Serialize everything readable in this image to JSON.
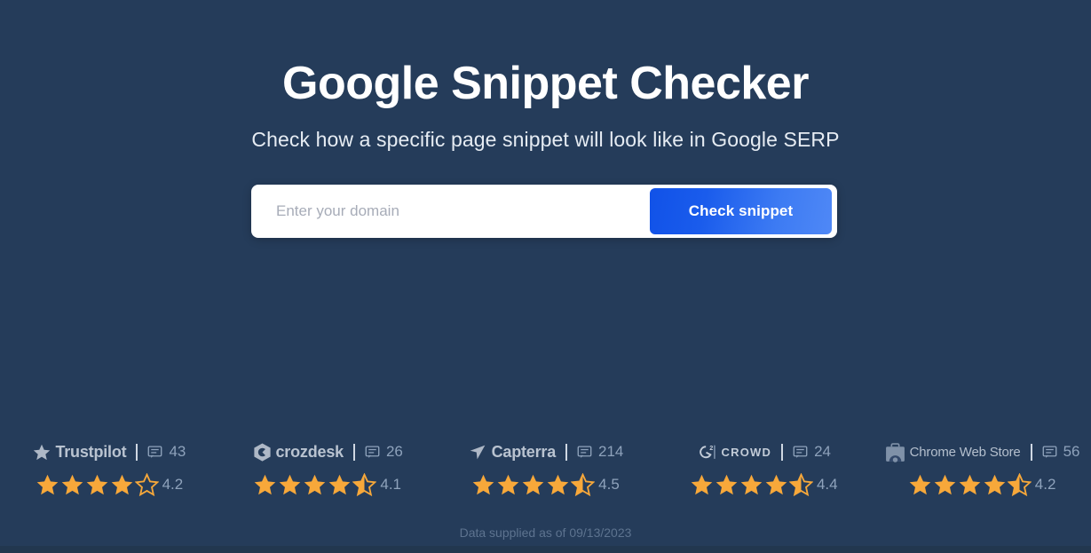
{
  "hero": {
    "title": "Google Snippet Checker",
    "subtitle": "Check how a specific page snippet will look like in Google SERP"
  },
  "search": {
    "placeholder": "Enter your domain",
    "value": "",
    "button_label": "Check snippet"
  },
  "badges": [
    {
      "brand": "Trustpilot",
      "icon": "trustpilot-star-icon",
      "reviews_count": "43",
      "rating": "4.2",
      "full_stars": 4,
      "half_stars": 0,
      "empty_stars": 1
    },
    {
      "brand": "crozdesk",
      "icon": "crozdesk-logo-icon",
      "reviews_count": "26",
      "rating": "4.1",
      "full_stars": 4,
      "half_stars": 1,
      "empty_stars": 0
    },
    {
      "brand": "Capterra",
      "icon": "capterra-arrow-icon",
      "reviews_count": "214",
      "rating": "4.5",
      "full_stars": 4,
      "half_stars": 1,
      "empty_stars": 0
    },
    {
      "brand": "CROWD",
      "icon": "g2-crowd-logo-icon",
      "reviews_count": "24",
      "rating": "4.4",
      "full_stars": 4,
      "half_stars": 1,
      "empty_stars": 0
    },
    {
      "brand": "Chrome Web Store",
      "icon": "chrome-web-store-icon",
      "reviews_count": "56",
      "rating": "4.2",
      "full_stars": 4,
      "half_stars": 1,
      "empty_stars": 0
    }
  ],
  "footer": {
    "note": "Data supplied as of 09/13/2023"
  },
  "colors": {
    "background": "#253c5a",
    "star": "#f7a83a",
    "button_gradient_start": "#1152e8",
    "button_gradient_end": "#4f88f6",
    "muted_text": "#8ea2bb"
  }
}
